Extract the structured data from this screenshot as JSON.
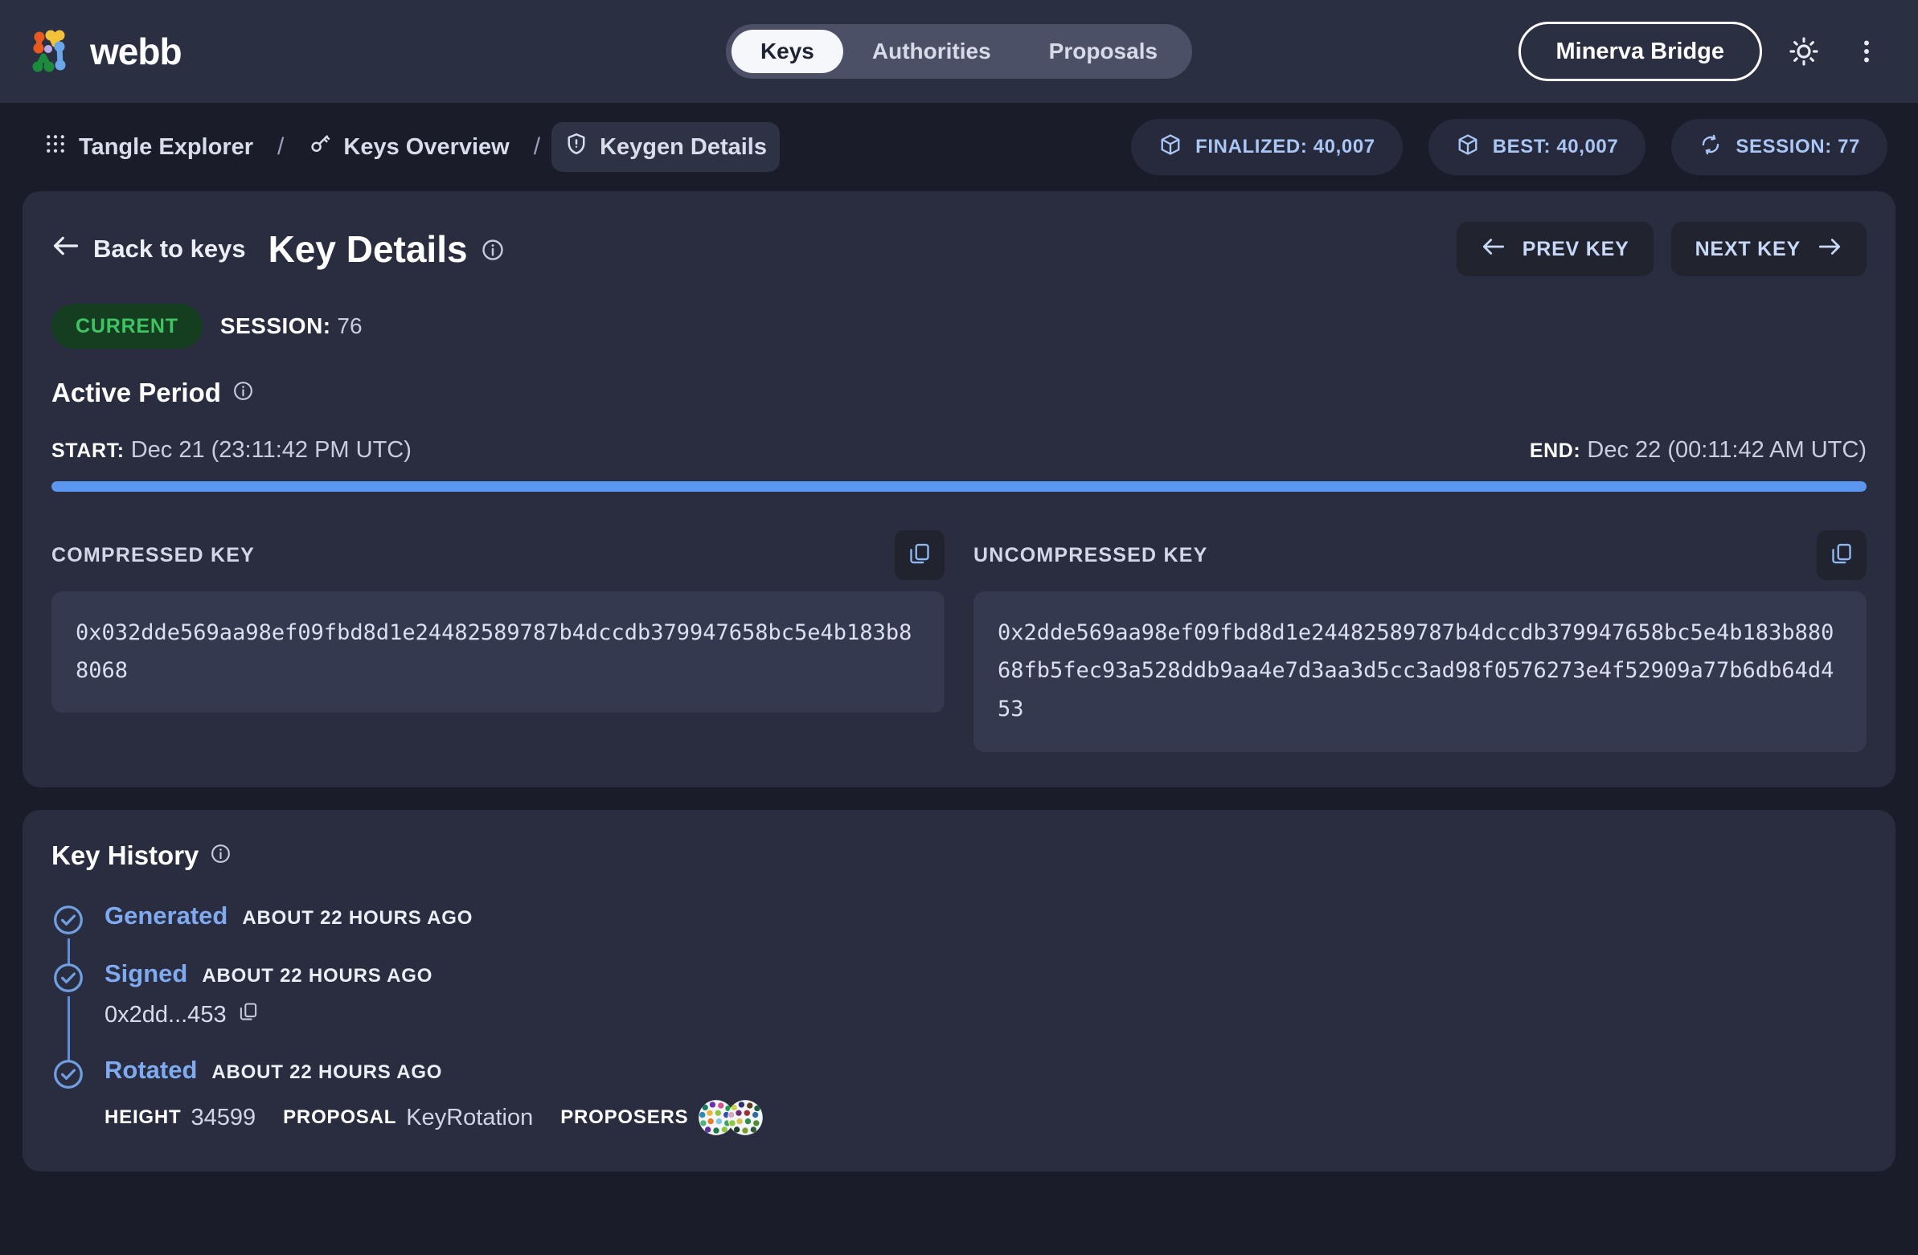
{
  "brand": {
    "name": "webb",
    "logo_icon": "webb-logo-icon"
  },
  "nav": {
    "tabs": [
      {
        "label": "Keys",
        "active": true
      },
      {
        "label": "Authorities",
        "active": false
      },
      {
        "label": "Proposals",
        "active": false
      }
    ],
    "bridge_selector": "Minerva Bridge",
    "theme_toggle_icon": "sun-icon",
    "more_menu_icon": "vertical-dots-icon"
  },
  "breadcrumb": {
    "items": [
      {
        "label": "Tangle Explorer",
        "icon": "grid-icon",
        "active": false
      },
      {
        "label": "Keys Overview",
        "icon": "key-icon",
        "active": false
      },
      {
        "label": "Keygen Details",
        "icon": "shield-icon",
        "active": true
      }
    ],
    "separator": "/"
  },
  "status_chips": [
    {
      "label": "FINALIZED: 40,007",
      "icon": "cube-icon"
    },
    {
      "label": "BEST: 40,007",
      "icon": "cube-icon"
    },
    {
      "label": "SESSION: 77",
      "icon": "refresh-icon"
    }
  ],
  "key_details": {
    "back_label": "Back to keys",
    "title": "Key Details",
    "info_icon": "info-icon",
    "prev_label": "PREV KEY",
    "next_label": "NEXT KEY",
    "status_badge": "CURRENT",
    "session_label": "SESSION:",
    "session_value": "76",
    "active_period_title": "Active Period",
    "start_label": "START:",
    "start_value": "Dec 21 (23:11:42 PM UTC)",
    "end_label": "END:",
    "end_value": "Dec 22 (00:11:42 AM UTC)",
    "progress_percent": 100,
    "compressed": {
      "label": "COMPRESSED KEY",
      "value": "0x032dde569aa98ef09fbd8d1e24482589787b4dccdb379947658bc5e4b183b88068",
      "copy_icon": "copy-icon"
    },
    "uncompressed": {
      "label": "UNCOMPRESSED KEY",
      "value": "0x2dde569aa98ef09fbd8d1e24482589787b4dccdb379947658bc5e4b183b88068fb5fec93a528ddb9aa4e7d3aa3d5cc3ad98f0576273e4f52909a77b6db64d453",
      "copy_icon": "copy-icon"
    }
  },
  "key_history": {
    "title": "Key History",
    "info_icon": "info-icon",
    "items": [
      {
        "name": "Generated",
        "time": "ABOUT 22 HOURS AGO"
      },
      {
        "name": "Signed",
        "time": "ABOUT 22 HOURS AGO",
        "hash": "0x2dd...453"
      },
      {
        "name": "Rotated",
        "time": "ABOUT 22 HOURS AGO",
        "height_label": "HEIGHT",
        "height_value": "34599",
        "proposal_label": "PROPOSAL",
        "proposal_value": "KeyRotation",
        "proposers_label": "PROPOSERS"
      }
    ]
  },
  "colors": {
    "page_bg": "#1b1c2a",
    "card_bg": "#292d3f",
    "topbar_bg": "#2b2f42",
    "accent_blue": "#5b96f0",
    "chip_text": "#a9c6f5",
    "badge_green": "#3ec462",
    "badge_green_bg": "#153d1f"
  }
}
